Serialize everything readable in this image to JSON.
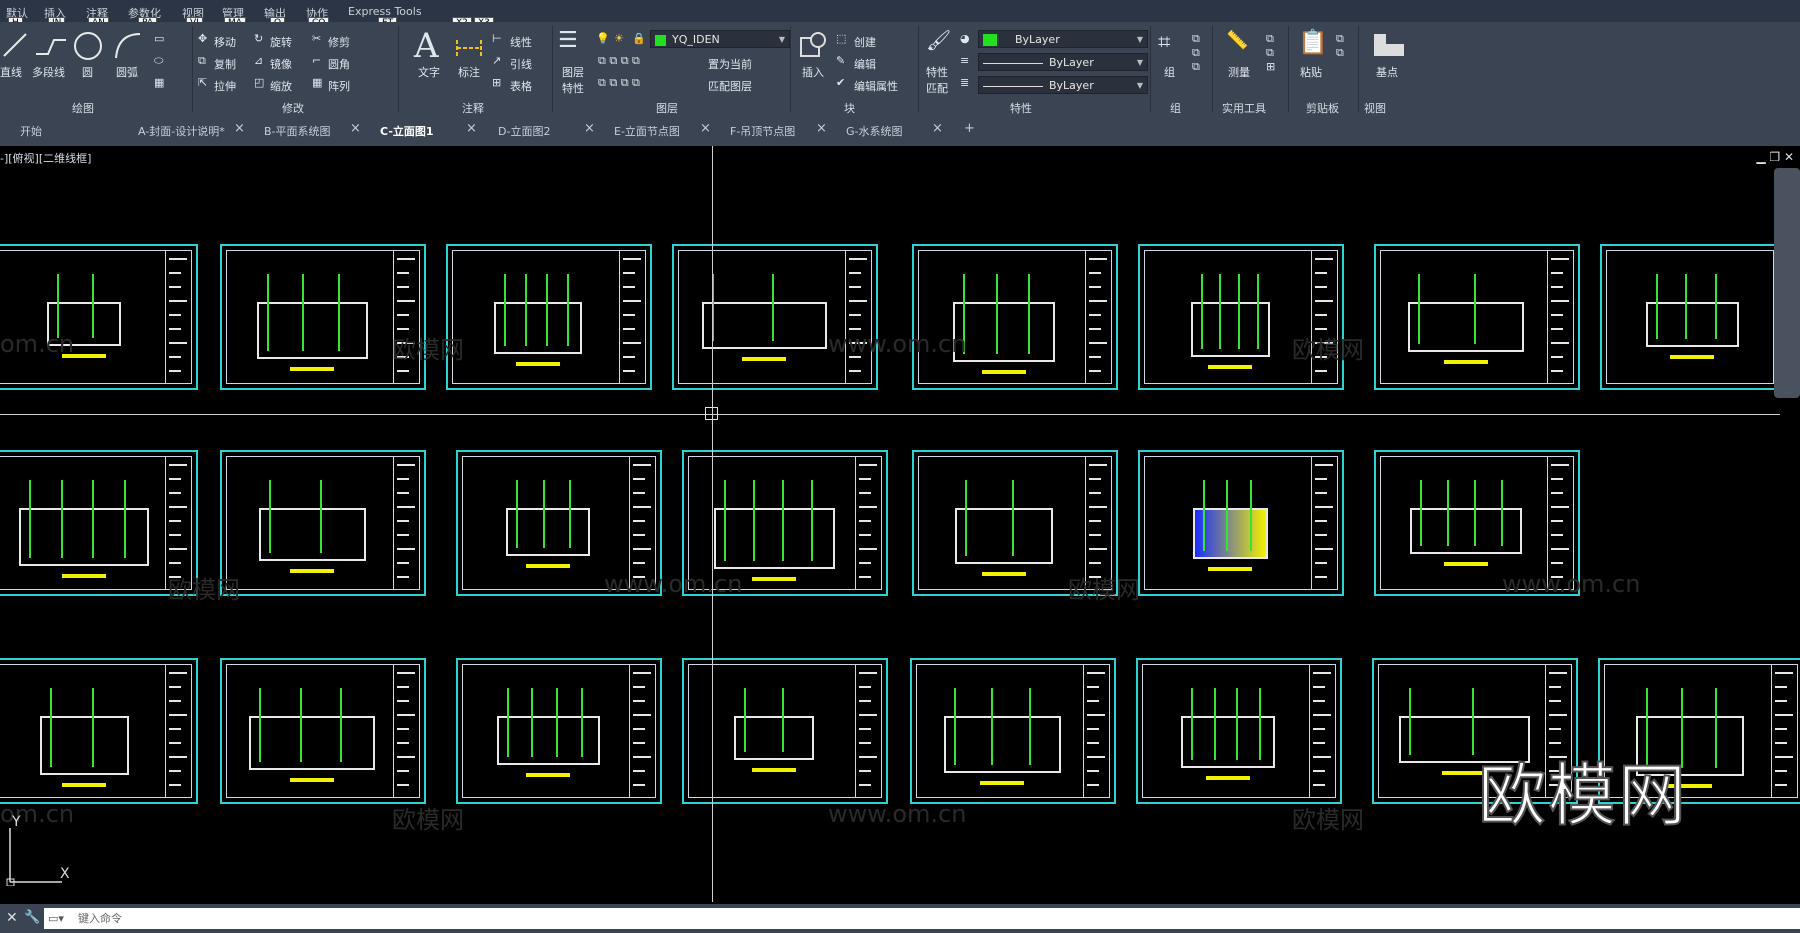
{
  "menu": [
    {
      "label": "默认",
      "key": "H"
    },
    {
      "label": "插入",
      "key": "IN"
    },
    {
      "label": "注释",
      "key": "AN"
    },
    {
      "label": "参数化",
      "key": "PA"
    },
    {
      "label": "视图",
      "key": "VI"
    },
    {
      "label": "管理",
      "key": "MA"
    },
    {
      "label": "输出",
      "key": "O"
    },
    {
      "label": "协作",
      "key": "CO"
    },
    {
      "label": "Express Tools",
      "key": "ET"
    }
  ],
  "menu_extra_keys": [
    "X2",
    "X3"
  ],
  "ribbon": {
    "draw": {
      "line": "直线",
      "polyline": "多段线",
      "circle": "圆",
      "arc": "圆弧",
      "title": "绘图"
    },
    "modify": {
      "move": "移动",
      "rotate": "旋转",
      "trim": "修剪",
      "copy": "复制",
      "mirror": "镜像",
      "fillet": "圆角",
      "stretch": "拉伸",
      "scale": "缩放",
      "array": "阵列",
      "title": "修改"
    },
    "annotation": {
      "text": "文字",
      "dimension": "标注",
      "linear": "线性",
      "leader": "引线",
      "table": "表格",
      "title": "注释"
    },
    "layers": {
      "layer_props": "图层",
      "layer_props2": "特性",
      "current_layer": "YQ_IDEN",
      "set_current": "置为当前",
      "match_layer": "匹配图层",
      "title": "图层"
    },
    "block": {
      "insert": "插入",
      "create": "创建",
      "edit": "编辑",
      "edit_attr": "编辑属性",
      "title": "块"
    },
    "properties": {
      "match": "特性",
      "match2": "匹配",
      "color": "ByLayer",
      "linetype": "ByLayer",
      "lineweight": "ByLayer",
      "title": "特性"
    },
    "groups": {
      "group": "组",
      "title": "组"
    },
    "utilities": {
      "measure": "测量",
      "title": "实用工具"
    },
    "clipboard": {
      "paste": "粘贴",
      "title": "剪贴板"
    },
    "view": {
      "base": "基点",
      "title": "视图"
    }
  },
  "tabs": [
    {
      "label": "开始"
    },
    {
      "label": "A-封面-设计说明*"
    },
    {
      "label": "B-平面系统图"
    },
    {
      "label": "C-立面图1",
      "active": true
    },
    {
      "label": "D-立面图2"
    },
    {
      "label": "E-立面节点图"
    },
    {
      "label": "F-吊顶节点图"
    },
    {
      "label": "G-水系统图"
    }
  ],
  "viewport": {
    "label": "-][俯视][二维线框]"
  },
  "watermarks": {
    "brand": "欧模网",
    "url": "www.om.cn",
    "domain": "om.cn"
  },
  "ucs": {
    "x": "X",
    "y": "Y"
  },
  "command": {
    "placeholder": "键入命令"
  },
  "colors": {
    "sheet_frame": "#2dd3d3",
    "accent_yellow": "#f2f200",
    "accent_green": "#34e534",
    "ribbon_bg": "#3b4453"
  }
}
